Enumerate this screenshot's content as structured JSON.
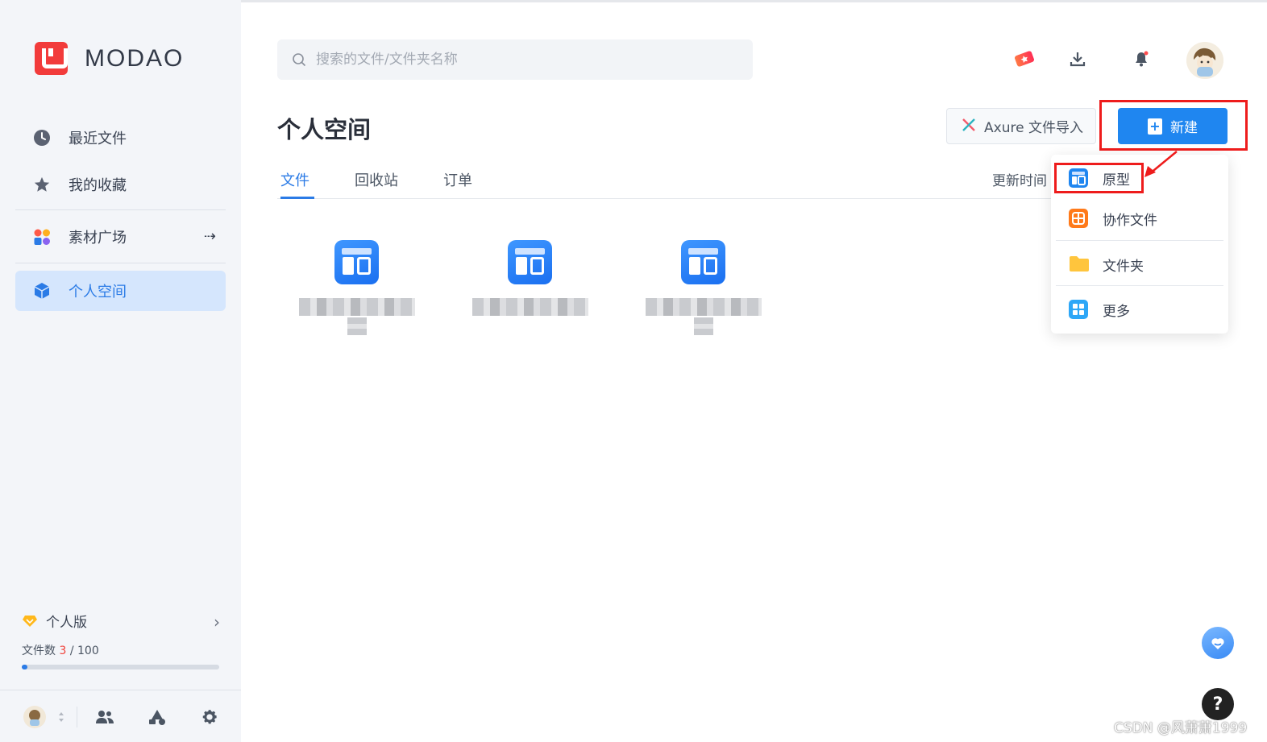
{
  "brand": {
    "name": "MODAO",
    "color": "#f23b3b"
  },
  "sidebar": {
    "items": [
      {
        "label": "最近文件",
        "icon": "clock-icon"
      },
      {
        "label": "我的收藏",
        "icon": "star-icon"
      },
      {
        "label": "素材广场",
        "icon": "shapes-icon",
        "arrow": "⇢"
      },
      {
        "label": "个人空间",
        "icon": "cube-icon",
        "active": true
      }
    ],
    "plan": {
      "label": "个人版",
      "files_label": "文件数",
      "files_used": "3",
      "files_sep": " / ",
      "files_total": "100",
      "progress": 0.03
    }
  },
  "search": {
    "placeholder": "搜索的文件/文件夹名称"
  },
  "header": {
    "title": "个人空间",
    "axure_button": "Axure 文件导入",
    "new_button": "新建"
  },
  "tabs": [
    "文件",
    "回收站",
    "订单"
  ],
  "sort_label": "更新时间",
  "dropdown": {
    "items": [
      {
        "label": "原型",
        "icon": "prototype-icon"
      },
      {
        "label": "协作文件",
        "icon": "collab-file-icon"
      },
      {
        "label": "文件夹",
        "icon": "folder-icon"
      },
      {
        "label": "更多",
        "icon": "more-grid-icon"
      }
    ]
  },
  "help_button": "?",
  "watermark": "CSDN @风萧萧1999",
  "colors": {
    "accent": "#1f86f0",
    "highlight": "#ee1c1c",
    "sidebar_bg": "#f3f5f9"
  }
}
